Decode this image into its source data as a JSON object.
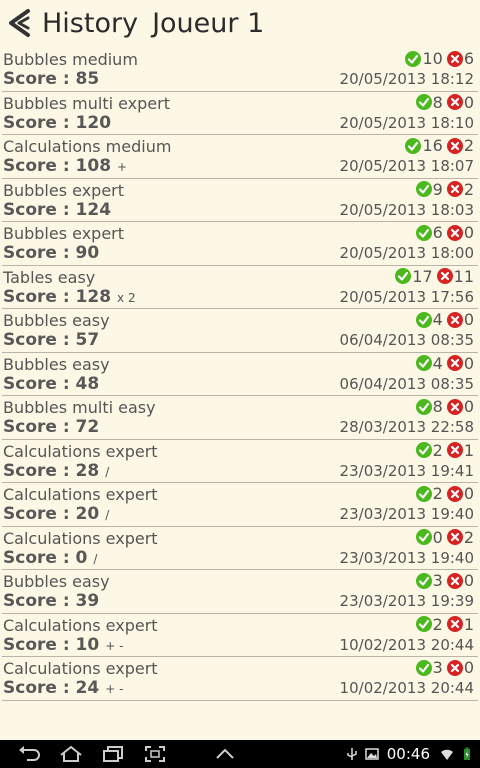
{
  "header": {
    "title": "History",
    "player": "Joueur 1"
  },
  "rows": [
    {
      "game": "Bubbles medium",
      "score": "Score : 85",
      "mod": "",
      "ok": "10",
      "ko": "6",
      "date": "20/05/2013 18:12"
    },
    {
      "game": "Bubbles multi expert",
      "score": "Score : 120",
      "mod": "",
      "ok": "8",
      "ko": "0",
      "date": "20/05/2013 18:10"
    },
    {
      "game": "Calculations medium",
      "score": "Score : 108",
      "mod": "+",
      "ok": "16",
      "ko": "2",
      "date": "20/05/2013 18:07"
    },
    {
      "game": "Bubbles expert",
      "score": "Score : 124",
      "mod": "",
      "ok": "9",
      "ko": "2",
      "date": "20/05/2013 18:03"
    },
    {
      "game": "Bubbles expert",
      "score": "Score : 90",
      "mod": "",
      "ok": "6",
      "ko": "0",
      "date": "20/05/2013 18:00"
    },
    {
      "game": "Tables easy",
      "score": "Score : 128",
      "mod": "x 2",
      "ok": "17",
      "ko": "11",
      "date": "20/05/2013 17:56"
    },
    {
      "game": "Bubbles easy",
      "score": "Score : 57",
      "mod": "",
      "ok": "4",
      "ko": "0",
      "date": "06/04/2013 08:35"
    },
    {
      "game": "Bubbles easy",
      "score": "Score : 48",
      "mod": "",
      "ok": "4",
      "ko": "0",
      "date": "06/04/2013 08:35"
    },
    {
      "game": "Bubbles multi easy",
      "score": "Score : 72",
      "mod": "",
      "ok": "8",
      "ko": "0",
      "date": "28/03/2013 22:58"
    },
    {
      "game": "Calculations expert",
      "score": "Score : 28",
      "mod": "/",
      "ok": "2",
      "ko": "1",
      "date": "23/03/2013 19:41"
    },
    {
      "game": "Calculations expert",
      "score": "Score : 20",
      "mod": "/",
      "ok": "2",
      "ko": "0",
      "date": "23/03/2013 19:40"
    },
    {
      "game": "Calculations expert",
      "score": "Score : 0",
      "mod": "/",
      "ok": "0",
      "ko": "2",
      "date": "23/03/2013 19:40"
    },
    {
      "game": "Bubbles easy",
      "score": "Score : 39",
      "mod": "",
      "ok": "3",
      "ko": "0",
      "date": "23/03/2013 19:39"
    },
    {
      "game": "Calculations expert",
      "score": "Score : 10",
      "mod": "+ -",
      "ok": "2",
      "ko": "1",
      "date": "10/02/2013 20:44"
    },
    {
      "game": "Calculations expert",
      "score": "Score : 24",
      "mod": "+ -",
      "ok": "3",
      "ko": "0",
      "date": "10/02/2013 20:44"
    }
  ],
  "status_bar": {
    "time": "00:46"
  },
  "colors": {
    "background": "#fdf8e6",
    "correct": "#4bb81e",
    "wrong": "#d62424"
  }
}
